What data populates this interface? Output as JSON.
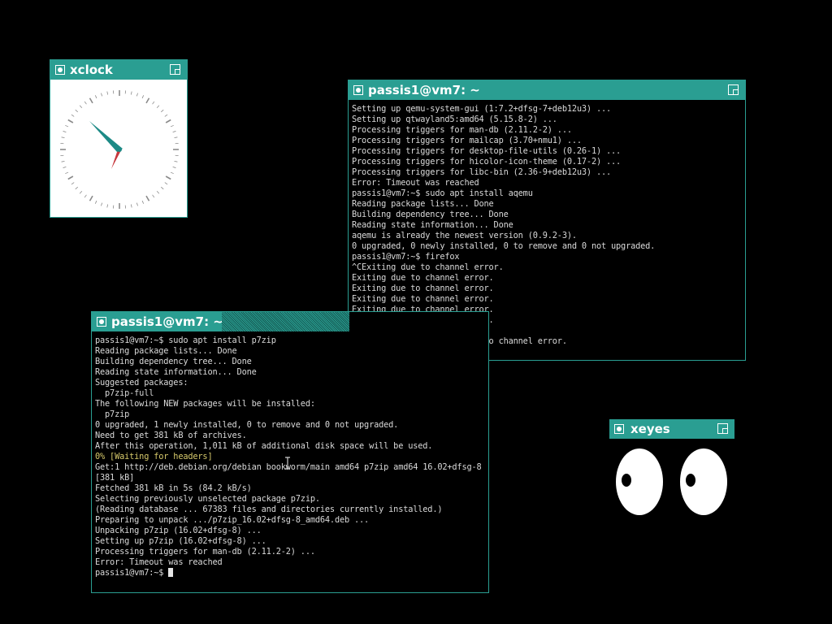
{
  "xclock": {
    "title": "xclock"
  },
  "term_top": {
    "title": "passis1@vm7: ~",
    "lines": [
      "Setting up qemu-system-gui (1:7.2+dfsg-7+deb12u3) ...",
      "Setting up qtwayland5:amd64 (5.15.8-2) ...",
      "Processing triggers for man-db (2.11.2-2) ...",
      "Processing triggers for mailcap (3.70+nmu1) ...",
      "Processing triggers for desktop-file-utils (0.26-1) ...",
      "Processing triggers for hicolor-icon-theme (0.17-2) ...",
      "Processing triggers for libc-bin (2.36-9+deb12u3) ...",
      "Error: Timeout was reached",
      "passis1@vm7:~$ sudo apt install aqemu",
      "Reading package lists... Done",
      "Building dependency tree... Done",
      "Reading state information... Done",
      "aqemu is already the newest version (0.9.2-3).",
      "0 upgraded, 0 newly installed, 0 to remove and 0 not upgraded.",
      "passis1@vm7:~$ firefox",
      "^CExiting due to channel error.",
      "Exiting due to channel error.",
      "Exiting due to channel error.",
      "Exiting due to channel error.",
      "Exiting due to channel error.",
      "Exiting due to channel error.",
      "",
      "passis1@vm7:~$ Exiting due to channel error."
    ]
  },
  "term_bottom": {
    "title": "passis1@vm7: ~",
    "lines_before": [
      "passis1@vm7:~$ sudo apt install p7zip",
      "Reading package lists... Done",
      "Building dependency tree... Done",
      "Reading state information... Done",
      "Suggested packages:",
      "  p7zip-full",
      "The following NEW packages will be installed:",
      "  p7zip",
      "0 upgraded, 1 newly installed, 0 to remove and 0 not upgraded.",
      "Need to get 381 kB of archives.",
      "After this operation, 1,011 kB of additional disk space will be used."
    ],
    "waiting_line": "0% [Waiting for headers]",
    "lines_after": [
      "Get:1 http://deb.debian.org/debian bookworm/main amd64 p7zip amd64 16.02+dfsg-8",
      "[381 kB]",
      "Fetched 381 kB in 5s (84.2 kB/s)",
      "Selecting previously unselected package p7zip.",
      "(Reading database ... 67383 files and directories currently installed.)",
      "Preparing to unpack .../p7zip_16.02+dfsg-8_amd64.deb ...",
      "Unpacking p7zip (16.02+dfsg-8) ...",
      "Setting up p7zip (16.02+dfsg-8) ...",
      "Processing triggers for man-db (2.11.2-2) ...",
      "Error: Timeout was reached"
    ],
    "prompt": "passis1@vm7:~$ "
  },
  "xeyes": {
    "title": "xeyes"
  },
  "colors": {
    "titlebar": "#2a9e92",
    "terminal_bg": "#000000",
    "terminal_fg": "#d9d9d9",
    "waiting_fg": "#d6c96b"
  }
}
